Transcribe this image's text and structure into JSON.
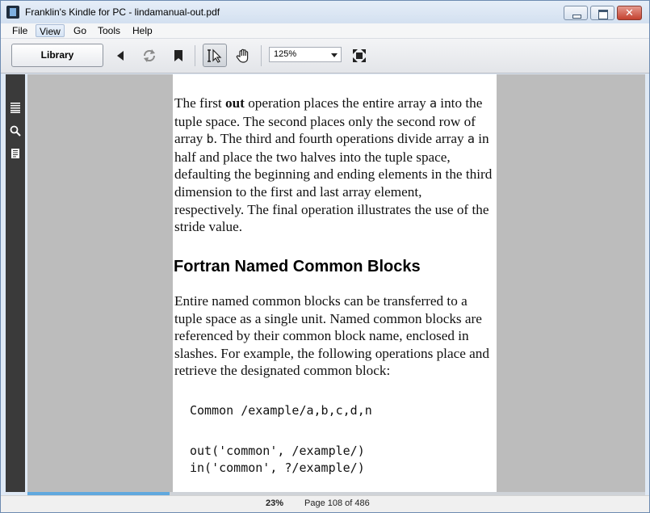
{
  "window": {
    "title": "Franklin's Kindle for PC - lindamanual-out.pdf"
  },
  "menu": {
    "items": [
      "File",
      "View",
      "Go",
      "Tools",
      "Help"
    ],
    "active": "View"
  },
  "toolbar": {
    "library_label": "Library",
    "zoom_value": "125%",
    "icons": [
      "back-icon",
      "sync-icon",
      "bookmark-icon",
      "select-tool-icon",
      "hand-tool-icon",
      "fullscreen-icon"
    ]
  },
  "sidebar": {
    "icons": [
      "contents-icon",
      "search-icon",
      "notes-icon"
    ]
  },
  "document": {
    "para1_runs": [
      {
        "text": "The first ",
        "style": "normal"
      },
      {
        "text": "out",
        "style": "bold"
      },
      {
        "text": " operation places the entire array ",
        "style": "normal"
      },
      {
        "text": "a",
        "style": "mono"
      },
      {
        "text": " into the tuple space. The second places only the second row of array ",
        "style": "normal"
      },
      {
        "text": "b",
        "style": "mono"
      },
      {
        "text": ". The third and fourth operations divide array ",
        "style": "normal"
      },
      {
        "text": "a",
        "style": "mono"
      },
      {
        "text": " in half and  place the two halves into the tuple space, defaulting the beginning and ending elements in the third dimension to the first and last array element, respectively. The final operation illustrates the use of the stride value.",
        "style": "normal"
      }
    ],
    "heading": "Fortran Named Common Blocks",
    "para2": "Entire named common blocks can be transferred to a tuple space as a single unit. Named common blocks are referenced by their common block name, enclosed in slashes. For  example, the following operations place and retrieve the designated common block:",
    "code": [
      "Common /example/a,b,c,d,n",
      "out('common', /example/)",
      "in('common', ?/example/)"
    ]
  },
  "status": {
    "percent": "23%",
    "page_label": "Page 108 of 486",
    "progress": 0.23
  },
  "colors": {
    "progress": "#60a8de",
    "rail": "#3a3a3a",
    "doc_background": "#bcbcbc"
  }
}
